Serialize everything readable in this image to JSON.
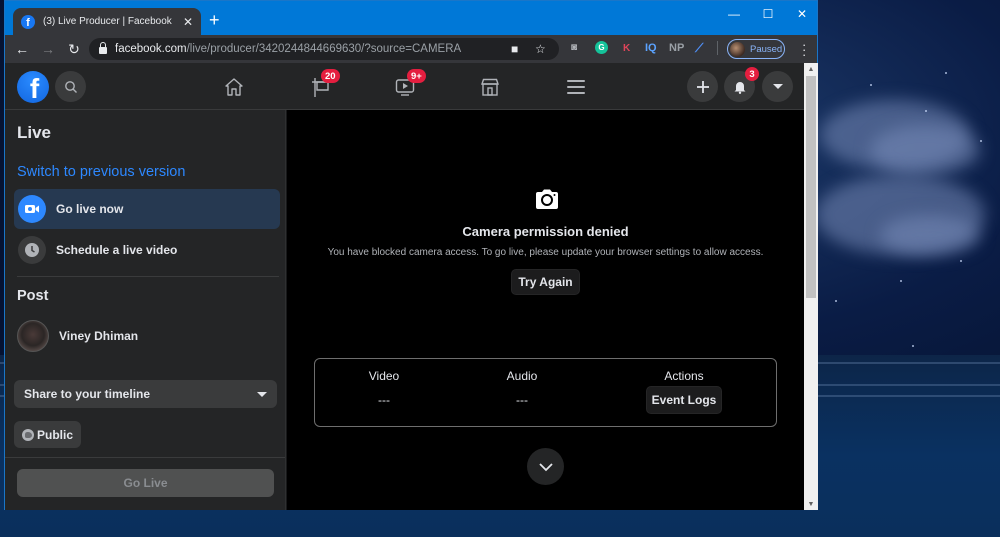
{
  "browser": {
    "tab_title": "(3) Live Producer | Facebook",
    "tab_close": "✕",
    "new_tab": "+",
    "url_host": "facebook.com",
    "url_path": "/live/producer/3420244844669630/?source=CAMERA",
    "profile_label": "Paused",
    "extensions": [
      {
        "name": "camera-extension",
        "label": "📷"
      },
      {
        "name": "grammarly-extension",
        "label": "G"
      },
      {
        "name": "k-extension",
        "label": "K"
      },
      {
        "name": "iq-extension",
        "label": "IQ"
      },
      {
        "name": "np-extension",
        "label": "NP"
      },
      {
        "name": "feather-extension",
        "label": "⟋"
      }
    ],
    "window_controls": {
      "minimize": "—",
      "maximize": "☐",
      "close": "✕"
    }
  },
  "fb_nav": {
    "logo": "f",
    "badges": {
      "pages": "20",
      "watch": "9+",
      "notifications": "3"
    }
  },
  "sidebar": {
    "title": "Live",
    "switch_link": "Switch to previous version",
    "items": [
      {
        "label": "Go live now",
        "icon": "video-camera-icon",
        "active": true
      },
      {
        "label": "Schedule a live video",
        "icon": "clock-icon",
        "active": false
      }
    ],
    "post_title": "Post",
    "user_name": "Viney Dhiman",
    "share_select": "Share to your timeline",
    "privacy": "Public",
    "go_live_button": "Go Live"
  },
  "main": {
    "error_title": "Camera permission denied",
    "error_message": "You have blocked camera access. To go live, please update your browser settings to allow access.",
    "try_again": "Try Again",
    "status": {
      "video_label": "Video",
      "video_value": "---",
      "audio_label": "Audio",
      "audio_value": "---",
      "actions_label": "Actions",
      "event_logs": "Event Logs"
    }
  },
  "colors": {
    "fb_blue": "#1877f2",
    "link_blue": "#2d88ff",
    "badge_red": "#e41e3f",
    "window_blue": "#0078d7"
  }
}
